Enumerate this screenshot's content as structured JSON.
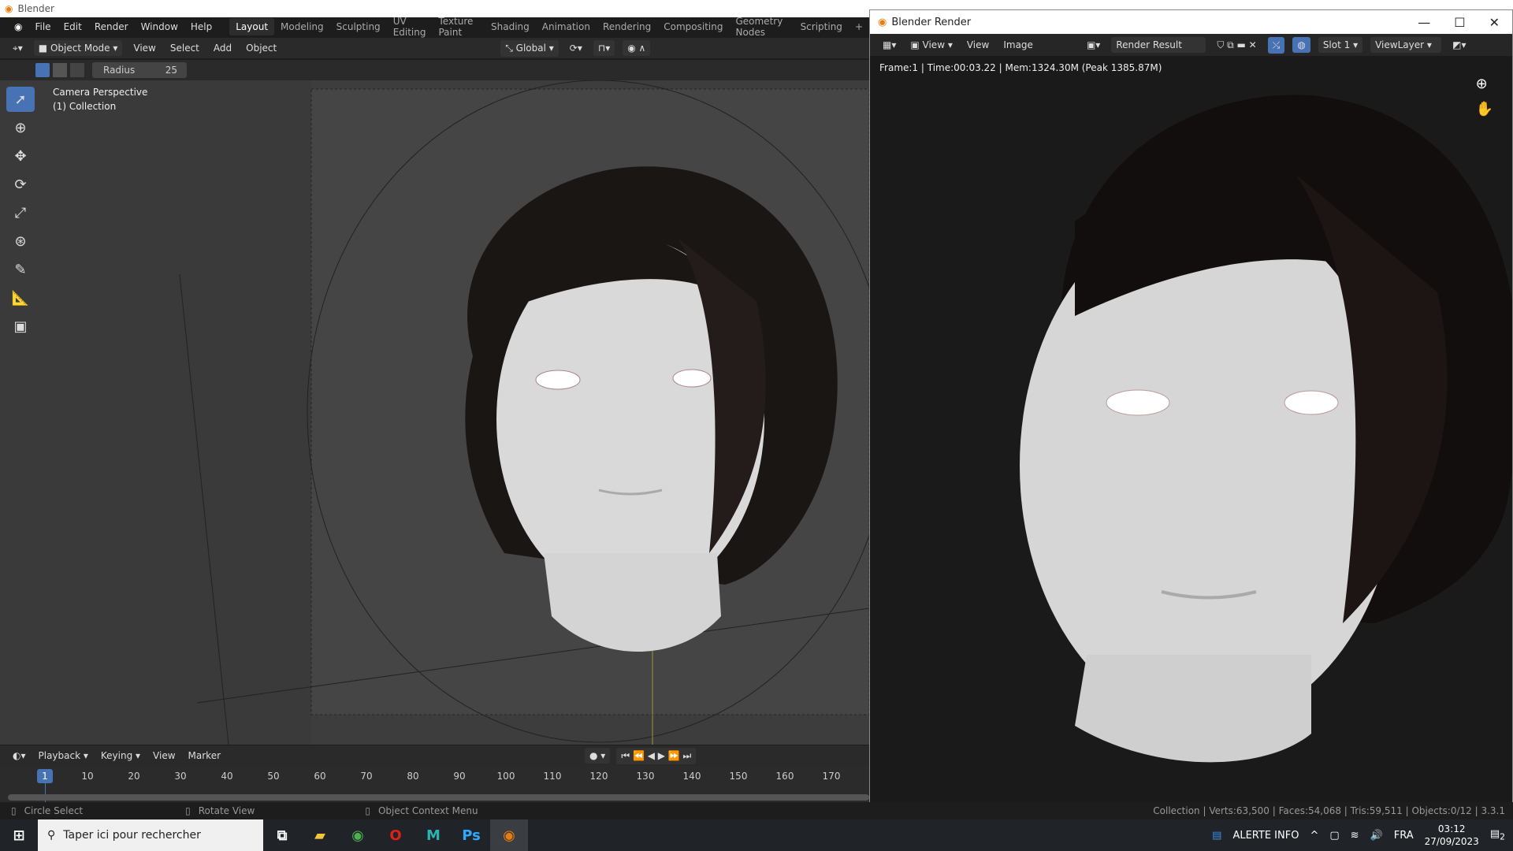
{
  "app": {
    "title": "Blender"
  },
  "menu": {
    "items": [
      "File",
      "Edit",
      "Render",
      "Window",
      "Help"
    ],
    "workspaces": [
      "Layout",
      "Modeling",
      "Sculpting",
      "UV Editing",
      "Texture Paint",
      "Shading",
      "Animation",
      "Rendering",
      "Compositing",
      "Geometry Nodes",
      "Scripting"
    ],
    "active_workspace": "Layout",
    "add": "+"
  },
  "header": {
    "mode": "Object Mode",
    "menus": [
      "View",
      "Select",
      "Add",
      "Object"
    ],
    "orientation": "Global"
  },
  "tool_settings": {
    "radius_label": "Radius",
    "radius_value": "25"
  },
  "viewport": {
    "view_name": "Camera Perspective",
    "collection": "(1) Collection"
  },
  "render_window": {
    "title": "Blender Render",
    "view_dropdown": "View",
    "menus": [
      "View",
      "Image"
    ],
    "image_name": "Render Result",
    "slot": "Slot 1",
    "view_layer": "ViewLayer",
    "info": "Frame:1 | Time:00:03.22 | Mem:1324.30M (Peak 1385.87M)"
  },
  "timeline": {
    "menus": [
      "Playback",
      "Keying",
      "View",
      "Marker"
    ],
    "current_frame": "1",
    "frames": [
      "10",
      "20",
      "30",
      "40",
      "50",
      "60",
      "70",
      "80",
      "90",
      "100",
      "110",
      "120",
      "130",
      "140",
      "150",
      "160",
      "170"
    ]
  },
  "statusbar": {
    "left": "Circle Select",
    "middle": "Rotate View",
    "right": "Object Context Menu",
    "stats": "Collection | Verts:63,500 | Faces:54,068 | Tris:59,511 | Objects:0/12 | 3.3.1"
  },
  "taskbar": {
    "search_placeholder": "Taper ici pour rechercher",
    "news": "ALERTE INFO",
    "lang": "FRA",
    "time": "03:12",
    "date": "27/09/2023",
    "notifications": "2"
  }
}
